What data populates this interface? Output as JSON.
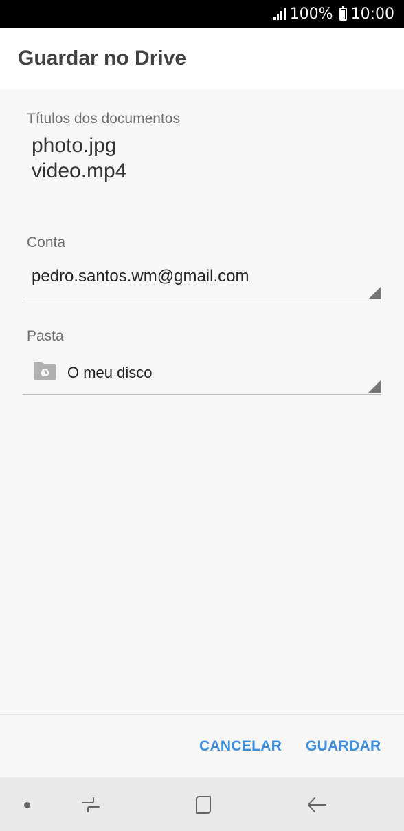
{
  "status_bar": {
    "battery": "100%",
    "time": "10:00"
  },
  "header": {
    "title": "Guardar no Drive"
  },
  "documents": {
    "label": "Títulos dos documentos",
    "titles": [
      "photo.jpg",
      "video.mp4"
    ]
  },
  "account": {
    "label": "Conta",
    "value": "pedro.santos.wm@gmail.com"
  },
  "folder": {
    "label": "Pasta",
    "value": "O meu disco"
  },
  "actions": {
    "cancel": "CANCELAR",
    "save": "GUARDAR"
  },
  "nav": {
    "icons": [
      "dot-icon",
      "recent-apps-icon",
      "home-icon",
      "back-icon"
    ]
  },
  "colors": {
    "accent": "#3b8ee0",
    "status_bar": "#000000",
    "content_bg": "#f7f7f7",
    "nav_bg": "#e9e9e9"
  }
}
